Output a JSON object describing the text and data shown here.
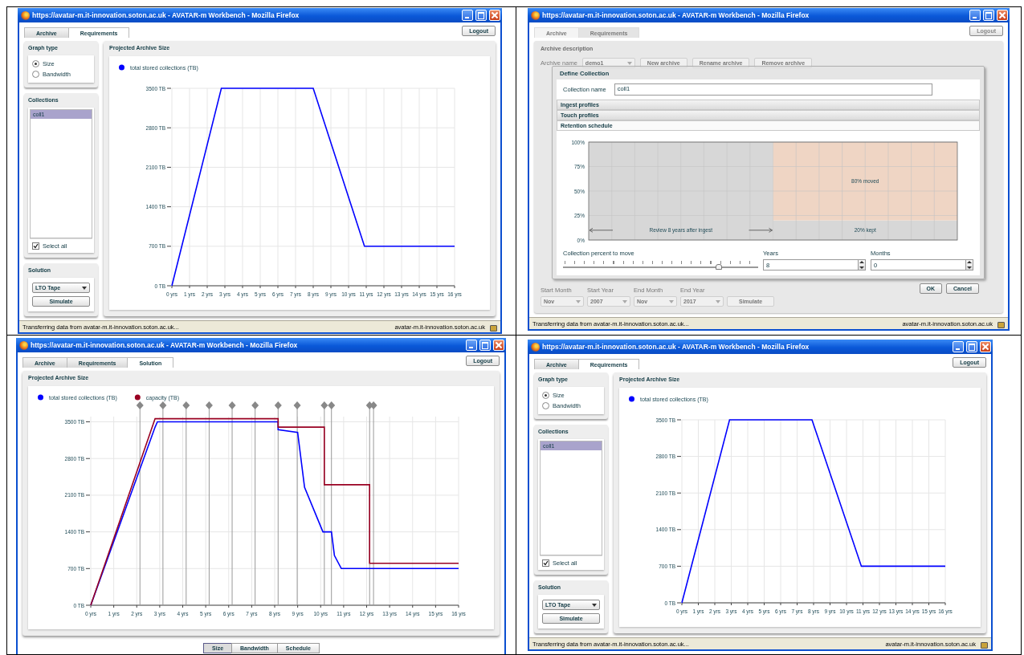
{
  "panels": [
    {
      "kind": "requirements",
      "window": {
        "title": "https://avatar-m.it-innovation.soton.ac.uk - AVATAR-m Workbench - Mozilla Firefox",
        "status_left": "Transferring data from avatar-m.it-innovation.soton.ac.uk...",
        "status_right": "avatar-m.it-innovation.soton.ac.uk"
      },
      "tabs": [
        {
          "label": "Archive",
          "selected": false
        },
        {
          "label": "Requirements",
          "selected": true
        }
      ],
      "logout": "Logout",
      "graph_type": {
        "title": "Graph type",
        "options": [
          {
            "label": "Size",
            "selected": true
          },
          {
            "label": "Bandwidth",
            "selected": false
          }
        ]
      },
      "collections": {
        "title": "Collections",
        "items": [
          {
            "label": "coll1",
            "selected": true
          }
        ],
        "select_all": {
          "label": "Select all",
          "checked": true
        }
      },
      "solution": {
        "title": "Solution",
        "dropdown": "LTO Tape",
        "button": "Simulate"
      },
      "chart_panel": {
        "title": "Projected Archive Size",
        "chart_data": {
          "type": "line",
          "grid": true,
          "legend": "top-left",
          "x": [
            0,
            2.8,
            8,
            10.9,
            16
          ],
          "xlim": [
            0,
            16
          ],
          "ylim": [
            0,
            3500
          ],
          "xticks": [
            {
              "value": 0,
              "label": "0 yrs"
            },
            {
              "value": 1,
              "label": "1 yrs"
            },
            {
              "value": 2,
              "label": "2 yrs"
            },
            {
              "value": 3,
              "label": "3 yrs"
            },
            {
              "value": 4,
              "label": "4 yrs"
            },
            {
              "value": 5,
              "label": "5 yrs"
            },
            {
              "value": 6,
              "label": "6 yrs"
            },
            {
              "value": 7,
              "label": "7 yrs"
            },
            {
              "value": 8,
              "label": "8 yrs"
            },
            {
              "value": 9,
              "label": "9 yrs"
            },
            {
              "value": 10,
              "label": "10 yrs"
            },
            {
              "value": 11,
              "label": "11 yrs"
            },
            {
              "value": 12,
              "label": "12 yrs"
            },
            {
              "value": 13,
              "label": "13 yrs"
            },
            {
              "value": 14,
              "label": "14 yrs"
            },
            {
              "value": 15,
              "label": "15 yrs"
            },
            {
              "value": 16,
              "label": "16 yrs"
            }
          ],
          "yticks": [
            {
              "value": 0,
              "label": "0 TB"
            },
            {
              "value": 700,
              "label": "700 TB"
            },
            {
              "value": 1400,
              "label": "1400 TB"
            },
            {
              "value": 2100,
              "label": "2100 TB"
            },
            {
              "value": 2800,
              "label": "2800 TB"
            },
            {
              "value": 3500,
              "label": "3500 TB"
            }
          ],
          "series": [
            {
              "name": "total stored collections (TB)",
              "color": "#0000ff",
              "values": [
                0,
                3500,
                3500,
                700,
                700
              ]
            }
          ]
        }
      }
    },
    {
      "kind": "dialog",
      "window": {
        "title": "https://avatar-m.it-innovation.soton.ac.uk - AVATAR-m Workbench - Mozilla Firefox",
        "status_left": "Transferring data from avatar-m.it-innovation.soton.ac.uk...",
        "status_right": "avatar-m.it-innovation.soton.ac.uk"
      },
      "tabs": [
        {
          "label": "Archive",
          "selected": true
        },
        {
          "label": "Requirements",
          "selected": false
        }
      ],
      "logout": "Logout",
      "background": {
        "title": "Archive description",
        "archive_name": {
          "label": "Archive name",
          "value": "demo1"
        },
        "buttons": [
          "New archive",
          "Rename archive",
          "Remove archive"
        ],
        "fields": [
          {
            "label": "Start Month",
            "value": "Nov"
          },
          {
            "label": "Start Year",
            "value": "2007"
          },
          {
            "label": "End Month",
            "value": "Nov"
          },
          {
            "label": "End Year",
            "value": "2017"
          }
        ],
        "simulate": "Simulate"
      },
      "dialog": {
        "title": "Define Collection",
        "name_label": "Collection name",
        "name_value": "coll1",
        "sections": [
          {
            "title": "Ingest profiles",
            "expanded": false
          },
          {
            "title": "Touch profiles",
            "expanded": false
          },
          {
            "title": "Retention schedule",
            "expanded": true
          }
        ],
        "chart_data": {
          "type": "bar",
          "stacked": true,
          "grid": true,
          "categories": [
            null,
            null
          ],
          "ylim": [
            0,
            100
          ],
          "yticks": [
            {
              "value": 0,
              "label": "0%"
            },
            {
              "value": 25,
              "label": "25%"
            },
            {
              "value": 50,
              "label": "50%"
            },
            {
              "value": 75,
              "label": "75%"
            },
            {
              "value": 100,
              "label": "100%"
            }
          ],
          "series": [
            {
              "color": "#d7d7d7",
              "values": [
                100,
                20
              ]
            },
            {
              "color": "#efd5c4",
              "values": [
                0,
                80
              ]
            }
          ]
        },
        "chart_labels": {
          "span": "Review 8 years after ingest",
          "upper": "80% moved",
          "lower": "20% kept"
        },
        "slider": {
          "label": "Collection percent to move",
          "level": 0.8
        },
        "years": {
          "label": "Years",
          "value": "8"
        },
        "months": {
          "label": "Months",
          "value": "0"
        },
        "buttons": [
          "OK",
          "Cancel"
        ]
      }
    },
    {
      "kind": "solution",
      "window": {
        "title": "https://avatar-m.it-innovation.soton.ac.uk - AVATAR-m Workbench - Mozilla Firefox"
      },
      "tabs": [
        {
          "label": "Archive",
          "selected": false
        },
        {
          "label": "Requirements",
          "selected": false
        },
        {
          "label": "Solution",
          "selected": true
        }
      ],
      "logout": "Logout",
      "chart_panel": {
        "title": "Projected Archive Size",
        "chart_data": {
          "type": "line",
          "grid": true,
          "legend": "top-left",
          "x": [
            0,
            2.8,
            2.9,
            8.15,
            8.15,
            9.0,
            9.3,
            10.1,
            10.16,
            10.16,
            10.47,
            10.6,
            10.9,
            12.13,
            12.13,
            16
          ],
          "xlim": [
            0,
            16
          ],
          "ylim": [
            0,
            3600
          ],
          "xticks": [
            {
              "value": 0,
              "label": "0 yrs"
            },
            {
              "value": 1,
              "label": "1 yrs"
            },
            {
              "value": 2,
              "label": "2 yrs"
            },
            {
              "value": 3,
              "label": "3 yrs"
            },
            {
              "value": 4,
              "label": "4 yrs"
            },
            {
              "value": 5,
              "label": "5 yrs"
            },
            {
              "value": 6,
              "label": "6 yrs"
            },
            {
              "value": 7,
              "label": "7 yrs"
            },
            {
              "value": 8,
              "label": "8 yrs"
            },
            {
              "value": 9,
              "label": "9 yrs"
            },
            {
              "value": 10,
              "label": "10 yrs"
            },
            {
              "value": 11,
              "label": "11 yrs"
            },
            {
              "value": 12,
              "label": "12 yrs"
            },
            {
              "value": 13,
              "label": "13 yrs"
            },
            {
              "value": 14,
              "label": "14 yrs"
            },
            {
              "value": 15,
              "label": "15 yrs"
            },
            {
              "value": 16,
              "label": "16 yrs"
            }
          ],
          "yticks": [
            {
              "value": 0,
              "label": "0 TB"
            },
            {
              "value": 700,
              "label": "700 TB"
            },
            {
              "value": 1400,
              "label": "1400 TB"
            },
            {
              "value": 2100,
              "label": "2100 TB"
            },
            {
              "value": 2800,
              "label": "2800 TB"
            },
            {
              "value": 3500,
              "label": "3500 TB"
            }
          ],
          "series": [
            {
              "name": "total stored collections (TB)",
              "color": "#0000ff",
              "values": [
                0,
                3400,
                3500,
                3500,
                3350,
                3300,
                2250,
                1400,
                1400,
                1400,
                1400,
                950,
                700,
                700,
                700,
                700
              ]
            },
            {
              "name": "capacity (TB)",
              "color": "#990022",
              "values": [
                0,
                3560,
                3560,
                3560,
                3400,
                3400,
                3400,
                3400,
                3400,
                2300,
                2300,
                2300,
                2300,
                2300,
                800,
                800
              ]
            }
          ],
          "ref_lines": [
            {
              "axis": "x",
              "value": 2.14
            },
            {
              "axis": "x",
              "value": 3.14
            },
            {
              "axis": "x",
              "value": 4.15
            },
            {
              "axis": "x",
              "value": 5.15
            },
            {
              "axis": "x",
              "value": 6.15
            },
            {
              "axis": "x",
              "value": 7.15
            },
            {
              "axis": "x",
              "value": 8.15
            },
            {
              "axis": "x",
              "value": 8.98
            },
            {
              "axis": "x",
              "value": 10.16
            },
            {
              "axis": "x",
              "value": 10.47
            },
            {
              "axis": "x",
              "value": 12.13
            },
            {
              "axis": "x",
              "value": 12.3
            }
          ]
        }
      },
      "view_buttons": [
        {
          "label": "Size",
          "selected": true
        },
        {
          "label": "Bandwidth",
          "selected": false
        },
        {
          "label": "Schedule",
          "selected": false
        }
      ]
    },
    {
      "kind": "requirements",
      "window": {
        "title": "https://avatar-m.it-innovation.soton.ac.uk - AVATAR-m Workbench - Mozilla Firefox",
        "status_left": "Transferring data from avatar-m.it-innovation.soton.ac.uk...",
        "status_right": "avatar-m.it-innovation.soton.ac.uk"
      },
      "tabs": [
        {
          "label": "Archive",
          "selected": false
        },
        {
          "label": "Requirements",
          "selected": true
        }
      ],
      "logout": "Logout",
      "graph_type": {
        "title": "Graph type",
        "options": [
          {
            "label": "Size",
            "selected": true
          },
          {
            "label": "Bandwidth",
            "selected": false
          }
        ]
      },
      "collections": {
        "title": "Collections",
        "items": [
          {
            "label": "coll1",
            "selected": true
          }
        ],
        "select_all": {
          "label": "Select all",
          "checked": true
        }
      },
      "solution": {
        "title": "Solution",
        "dropdown": "LTO Tape",
        "button": "Simulate"
      },
      "chart_panel": {
        "title": "Projected Archive Size",
        "chart_data": {
          "type": "line",
          "grid": true,
          "legend": "top-left",
          "x": [
            0,
            2.9,
            7.9,
            10.9,
            16
          ],
          "xlim": [
            0,
            16
          ],
          "ylim": [
            0,
            3500
          ],
          "xticks": [
            {
              "value": 0,
              "label": "0 yrs"
            },
            {
              "value": 1,
              "label": "1 yrs"
            },
            {
              "value": 2,
              "label": "2 yrs"
            },
            {
              "value": 3,
              "label": "3 yrs"
            },
            {
              "value": 4,
              "label": "4 yrs"
            },
            {
              "value": 5,
              "label": "5 yrs"
            },
            {
              "value": 6,
              "label": "6 yrs"
            },
            {
              "value": 7,
              "label": "7 yrs"
            },
            {
              "value": 8,
              "label": "8 yrs"
            },
            {
              "value": 9,
              "label": "9 yrs"
            },
            {
              "value": 10,
              "label": "10 yrs"
            },
            {
              "value": 11,
              "label": "11 yrs"
            },
            {
              "value": 12,
              "label": "12 yrs"
            },
            {
              "value": 13,
              "label": "13 yrs"
            },
            {
              "value": 14,
              "label": "14 yrs"
            },
            {
              "value": 15,
              "label": "15 yrs"
            },
            {
              "value": 16,
              "label": "16 yrs"
            }
          ],
          "yticks": [
            {
              "value": 0,
              "label": "0 TB"
            },
            {
              "value": 700,
              "label": "700 TB"
            },
            {
              "value": 1400,
              "label": "1400 TB"
            },
            {
              "value": 2100,
              "label": "2100 TB"
            },
            {
              "value": 2800,
              "label": "2800 TB"
            },
            {
              "value": 3500,
              "label": "3500 TB"
            }
          ],
          "series": [
            {
              "name": "total stored collections (TB)",
              "color": "#0000ff",
              "values": [
                0,
                3500,
                3500,
                700,
                700
              ]
            }
          ]
        }
      }
    }
  ]
}
